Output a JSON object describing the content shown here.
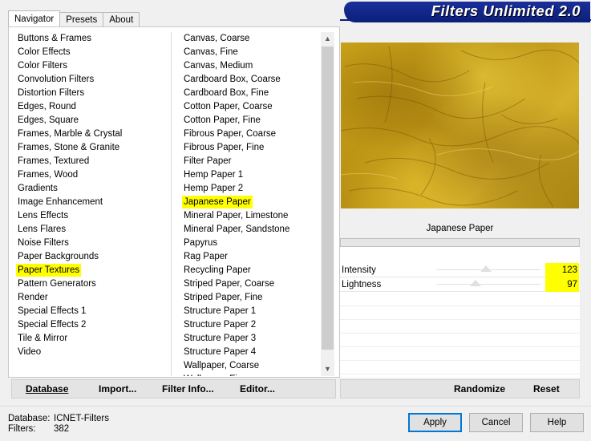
{
  "banner": {
    "title": "Filters Unlimited 2.0"
  },
  "tabs": [
    {
      "label": "Navigator",
      "active": true
    },
    {
      "label": "Presets",
      "active": false
    },
    {
      "label": "About",
      "active": false
    }
  ],
  "categories": [
    "Buttons & Frames",
    "Color Effects",
    "Color Filters",
    "Convolution Filters",
    "Distortion Filters",
    "Edges, Round",
    "Edges, Square",
    "Frames, Marble & Crystal",
    "Frames, Stone & Granite",
    "Frames, Textured",
    "Frames, Wood",
    "Gradients",
    "Image Enhancement",
    "Lens Effects",
    "Lens Flares",
    "Noise Filters",
    "Paper Backgrounds",
    "Paper Textures",
    "Pattern Generators",
    "Render",
    "Special Effects 1",
    "Special Effects 2",
    "Tile & Mirror",
    "Video"
  ],
  "selected_category": "Paper Textures",
  "filters": [
    "Canvas, Coarse",
    "Canvas, Fine",
    "Canvas, Medium",
    "Cardboard Box, Coarse",
    "Cardboard Box, Fine",
    "Cotton Paper, Coarse",
    "Cotton Paper, Fine",
    "Fibrous Paper, Coarse",
    "Fibrous Paper, Fine",
    "Filter Paper",
    "Hemp Paper 1",
    "Hemp Paper 2",
    "Japanese Paper",
    "Mineral Paper, Limestone",
    "Mineral Paper, Sandstone",
    "Papyrus",
    "Rag Paper",
    "Recycling Paper",
    "Striped Paper, Coarse",
    "Striped Paper, Fine",
    "Structure Paper 1",
    "Structure Paper 2",
    "Structure Paper 3",
    "Structure Paper 4",
    "Wallpaper, Coarse",
    "Wallpaper, Fine"
  ],
  "selected_filter": "Japanese Paper",
  "scrollbar": {
    "up_icon": "▲",
    "down_icon": "▼"
  },
  "panel_buttons": {
    "database": "Database",
    "import": "Import...",
    "filter_info": "Filter Info...",
    "editor": "Editor..."
  },
  "settings": {
    "filter_name": "Japanese Paper",
    "params": [
      {
        "label": "Intensity",
        "value": "123",
        "level": 0.48
      },
      {
        "label": "Lightness",
        "value": "97",
        "level": 0.38
      }
    ],
    "randomize": "Randomize",
    "reset": "Reset"
  },
  "footer": {
    "database_label": "Database:",
    "database_value": "ICNET-Filters",
    "filters_label": "Filters:",
    "filters_value": "382"
  },
  "dialog_buttons": {
    "apply": "Apply",
    "cancel": "Cancel",
    "help": "Help"
  },
  "colors": {
    "highlight": "#ffff00",
    "banner": "#0b1f7a",
    "preview_base": "#c9a319"
  }
}
